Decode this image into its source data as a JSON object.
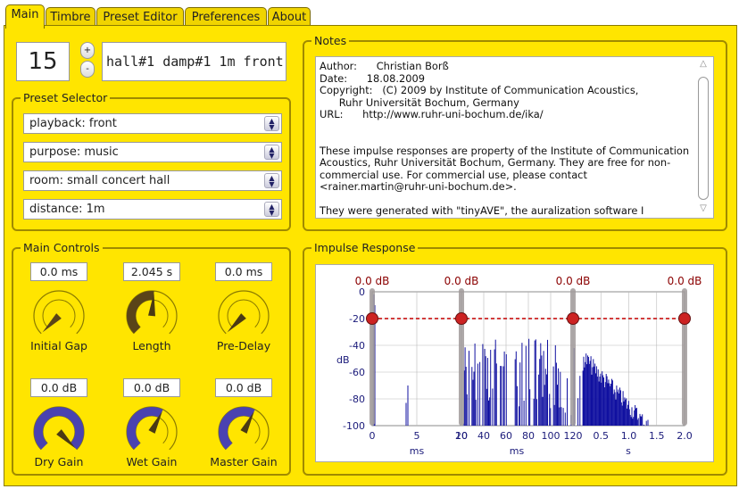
{
  "tabs": [
    {
      "label": "Main",
      "active": true
    },
    {
      "label": "Timbre",
      "active": false
    },
    {
      "label": "Preset Editor",
      "active": false
    },
    {
      "label": "Preferences",
      "active": false
    },
    {
      "label": "About",
      "active": false
    }
  ],
  "preset": {
    "number": "15",
    "up": "+",
    "down": "-",
    "name": "hall#1 damp#1 1m front"
  },
  "preset_selector": {
    "title": "Preset Selector",
    "options": [
      "playback: front",
      "purpose: music",
      "room: small concert hall",
      "distance: 1m"
    ]
  },
  "notes": {
    "title": "Notes",
    "text": "Author:      Christian Borß\nDate:      18.08.2009\nCopyright:   (C) 2009 by Institute of Communication Acoustics,\n      Ruhr Universität Bochum, Germany\nURL:      http://www.ruhr-uni-bochum.de/ika/\n\n\nThese impulse responses are property of the Institute of Communication Acoustics, Ruhr Universität Bochum, Germany. They are free for non-commercial use. For commercial use, please contact <rainer.martin@ruhr-uni-bochum.de>.\n\nThey were generated with \"tinyAVE\", the auralization software I"
  },
  "main_controls": {
    "title": "Main Controls",
    "knobs": [
      {
        "id": "initial-gap",
        "label": "Initial Gap",
        "value": "0.0 ms",
        "level": 0.0,
        "style": "light"
      },
      {
        "id": "length",
        "label": "Length",
        "value": "2.045 s",
        "level": 0.52,
        "style": "dark"
      },
      {
        "id": "pre-delay",
        "label": "Pre-Delay",
        "value": "0.0 ms",
        "level": 0.0,
        "style": "dark"
      },
      {
        "id": "dry-gain",
        "label": "Dry Gain",
        "value": "0.0 dB",
        "level": 1.0,
        "style": "blue"
      },
      {
        "id": "wet-gain",
        "label": "Wet Gain",
        "value": "0.0 dB",
        "level": 0.6,
        "style": "blue"
      },
      {
        "id": "master-gain",
        "label": "Master Gain",
        "value": "0.0 dB",
        "level": 0.6,
        "style": "blue"
      }
    ]
  },
  "impulse_response": {
    "title": "Impulse Response",
    "handle_labels": [
      "0.0 dB",
      "0.0 dB",
      "0.0 dB",
      "0.0 dB"
    ],
    "y_ticks": [
      "0",
      "-20",
      "-40",
      "-60",
      "-80",
      "-100"
    ],
    "y_label": "dB",
    "x_ticks_1": [
      "0",
      "5",
      "10"
    ],
    "x_ticks_2": [
      "20",
      "40",
      "60",
      "80",
      "100",
      "120"
    ],
    "x_ticks_3": [
      "0.5",
      "1.0",
      "1.5",
      "2.0"
    ],
    "unit_ms_1": "ms",
    "unit_ms_2": "ms",
    "unit_s": "s",
    "colors": {
      "axis": "#1a1a7a",
      "bars": "#1010a0",
      "handle": "#cc2222",
      "label": "#8b0000"
    }
  }
}
